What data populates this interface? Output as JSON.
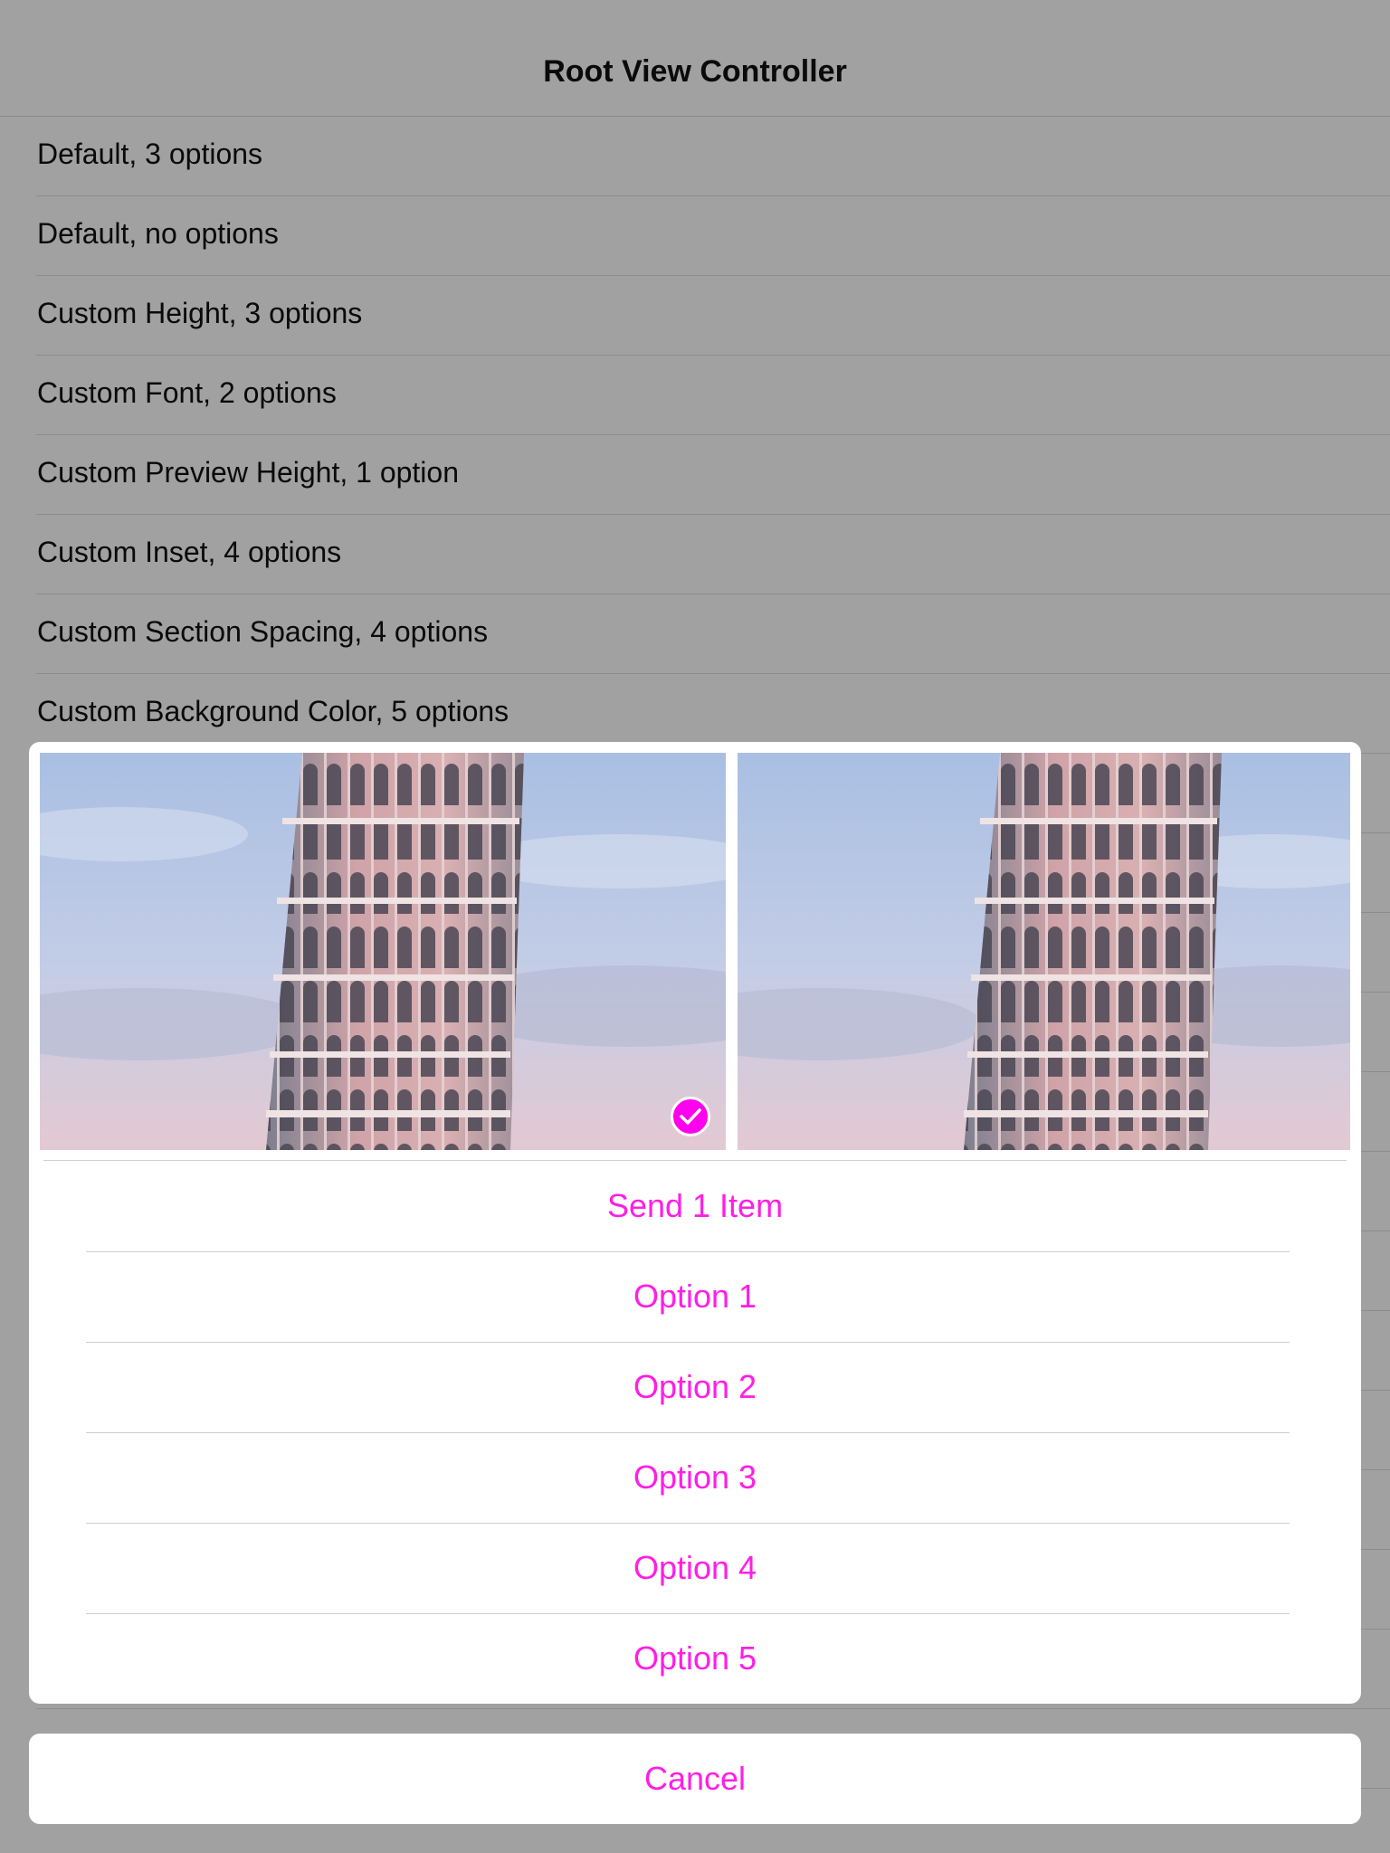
{
  "navbar": {
    "title": "Root View Controller"
  },
  "table": {
    "rows": [
      "Default, 3 options",
      "Default, no options",
      "Custom Height, 3 options",
      "Custom Font, 2 options",
      "Custom Preview Height, 1 option",
      "Custom Inset, 4 options",
      "Custom Section Spacing, 4 options",
      "Custom Background Color, 5 options"
    ]
  },
  "sheet": {
    "preview": {
      "photos": [
        {
          "subject": "leaning-tower-photo",
          "selected": true
        },
        {
          "subject": "leaning-tower-photo",
          "selected": false
        }
      ]
    },
    "actions": [
      "Send 1 Item",
      "Option 1",
      "Option 2",
      "Option 3",
      "Option 4",
      "Option 5"
    ],
    "cancel_label": "Cancel"
  },
  "colors": {
    "accent": "#ff1ee6",
    "check_badge": "#ff00ee",
    "dimmed_background": "#a1a1a1",
    "sheet_background": "#ffffff"
  }
}
